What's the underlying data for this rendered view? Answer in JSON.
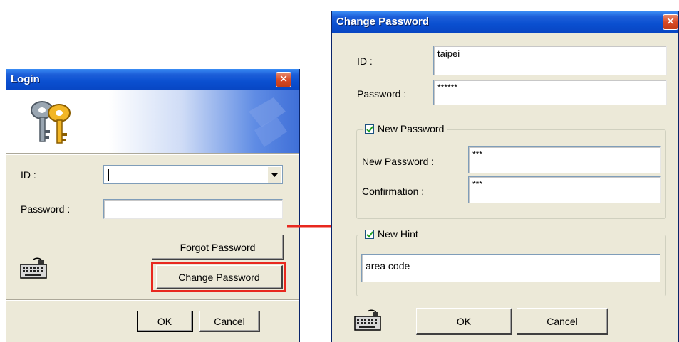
{
  "login": {
    "title": "Login",
    "id_label": "ID :",
    "id_value": "",
    "password_label": "Password :",
    "password_value": "",
    "forgot_password_label": "Forgot Password",
    "change_password_label": "Change Password",
    "ok_label": "OK",
    "cancel_label": "Cancel"
  },
  "change_password": {
    "title": "Change Password",
    "id_label": "ID :",
    "id_value": "taipei",
    "password_label": "Password :",
    "password_value": "******",
    "new_password_group": {
      "checkbox_label": "New Password",
      "checked": true,
      "new_password_label": "New Password :",
      "new_password_value": "***",
      "confirmation_label": "Confirmation :",
      "confirmation_value": "***"
    },
    "new_hint_group": {
      "checkbox_label": "New Hint",
      "checked": true,
      "hint_value": "area code"
    },
    "ok_label": "OK",
    "cancel_label": "Cancel"
  },
  "colors": {
    "highlight": "#e8281e",
    "arrow": "#e8281e",
    "titlebar": "#0a4fd0",
    "dialog_bg": "#ece9d8"
  },
  "icons": [
    "keys-icon",
    "keyboard-icon",
    "close-icon",
    "dropdown-arrow-icon",
    "checkbox-check-icon",
    "arrow-right-icon"
  ]
}
